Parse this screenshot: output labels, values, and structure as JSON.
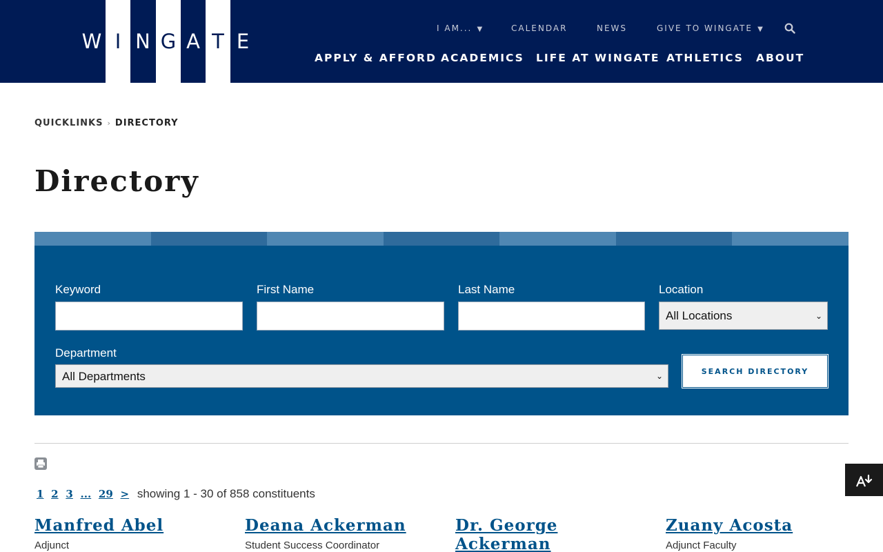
{
  "brand": {
    "logo_letters": [
      "W",
      "I",
      "N",
      "G",
      "A",
      "T",
      "E"
    ],
    "header_color": "#001b55",
    "accent_color": "#00538a"
  },
  "utility_nav": {
    "i_am": "I AM...",
    "calendar": "CALENDAR",
    "news": "NEWS",
    "give": "GIVE TO WINGATE",
    "search_icon": "search-icon"
  },
  "main_nav": {
    "apply": "APPLY & AFFORD",
    "academics": "ACADEMICS",
    "life": "LIFE AT WINGATE",
    "athletics": "ATHLETICS",
    "about": "ABOUT"
  },
  "breadcrumb": {
    "quicklinks": "QUICKLINKS",
    "current": "DIRECTORY"
  },
  "page_title": "Directory",
  "search_form": {
    "keyword_label": "Keyword",
    "first_name_label": "First Name",
    "last_name_label": "Last Name",
    "location_label": "Location",
    "location_value": "All Locations",
    "department_label": "Department",
    "department_value": "All Departments",
    "submit_label": "SEARCH DIRECTORY",
    "stripe_colors": [
      "#4f87b3",
      "#2f6b9c",
      "#4f87b3",
      "#2f6b9c",
      "#4f87b3",
      "#2f6b9c",
      "#4f87b3"
    ]
  },
  "pagination": {
    "pages": [
      "1",
      "2",
      "3",
      "...",
      "29",
      ">"
    ],
    "showing": "showing 1 - 30 of 858 constituents"
  },
  "people": [
    {
      "name": "Manfred Abel",
      "role": "Adjunct"
    },
    {
      "name": "Deana Ackerman",
      "role": "Student Success Coordinator"
    },
    {
      "name_line1": "Dr. George",
      "name_line2": "Ackerman",
      "role": ""
    },
    {
      "name": "Zuany Acosta",
      "role": "Adjunct Faculty"
    }
  ],
  "widgets": {
    "print_icon": "print-icon",
    "accessibility_download_icon": "download-accessibility-icon"
  }
}
